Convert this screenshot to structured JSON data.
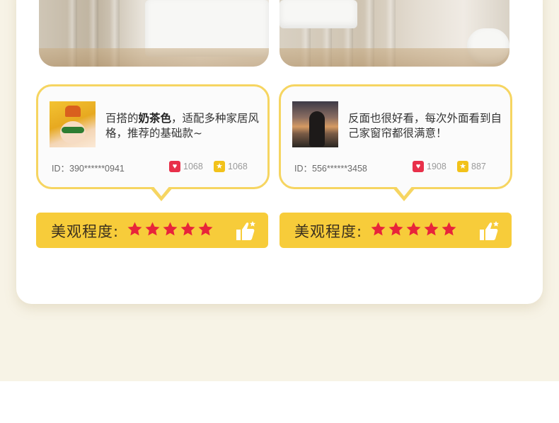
{
  "colors": {
    "accent_yellow": "#f7cc3a",
    "border_yellow": "#f6d561",
    "like_red": "#e8304a",
    "star_red": "#e8243a",
    "page_bg": "#f7f3e6"
  },
  "reviews": [
    {
      "text_pre": "百搭的",
      "text_bold": "奶茶色",
      "text_post": "，适配多种家居风格，推荐的基础款~",
      "id_label": "ID：",
      "id_value": "390******0941",
      "likes": "1068",
      "favorites": "1068",
      "rating_label": "美观程度:",
      "stars": 5,
      "avatar_icon": "avatar-baby-yellow-hat",
      "like_icon": "heart-icon",
      "fav_icon": "star-badge-icon",
      "thumb_icon": "thumbs-up-icon"
    },
    {
      "text_pre": "反面也很好看，每次外面看到自己家窗帘都很满意！",
      "text_bold": "",
      "text_post": "",
      "id_label": "ID：",
      "id_value": "556******3458",
      "likes": "1908",
      "favorites": "887",
      "rating_label": "美观程度:",
      "stars": 5,
      "avatar_icon": "avatar-woman-sunset",
      "like_icon": "heart-icon",
      "fav_icon": "star-badge-icon",
      "thumb_icon": "thumbs-up-icon"
    }
  ]
}
